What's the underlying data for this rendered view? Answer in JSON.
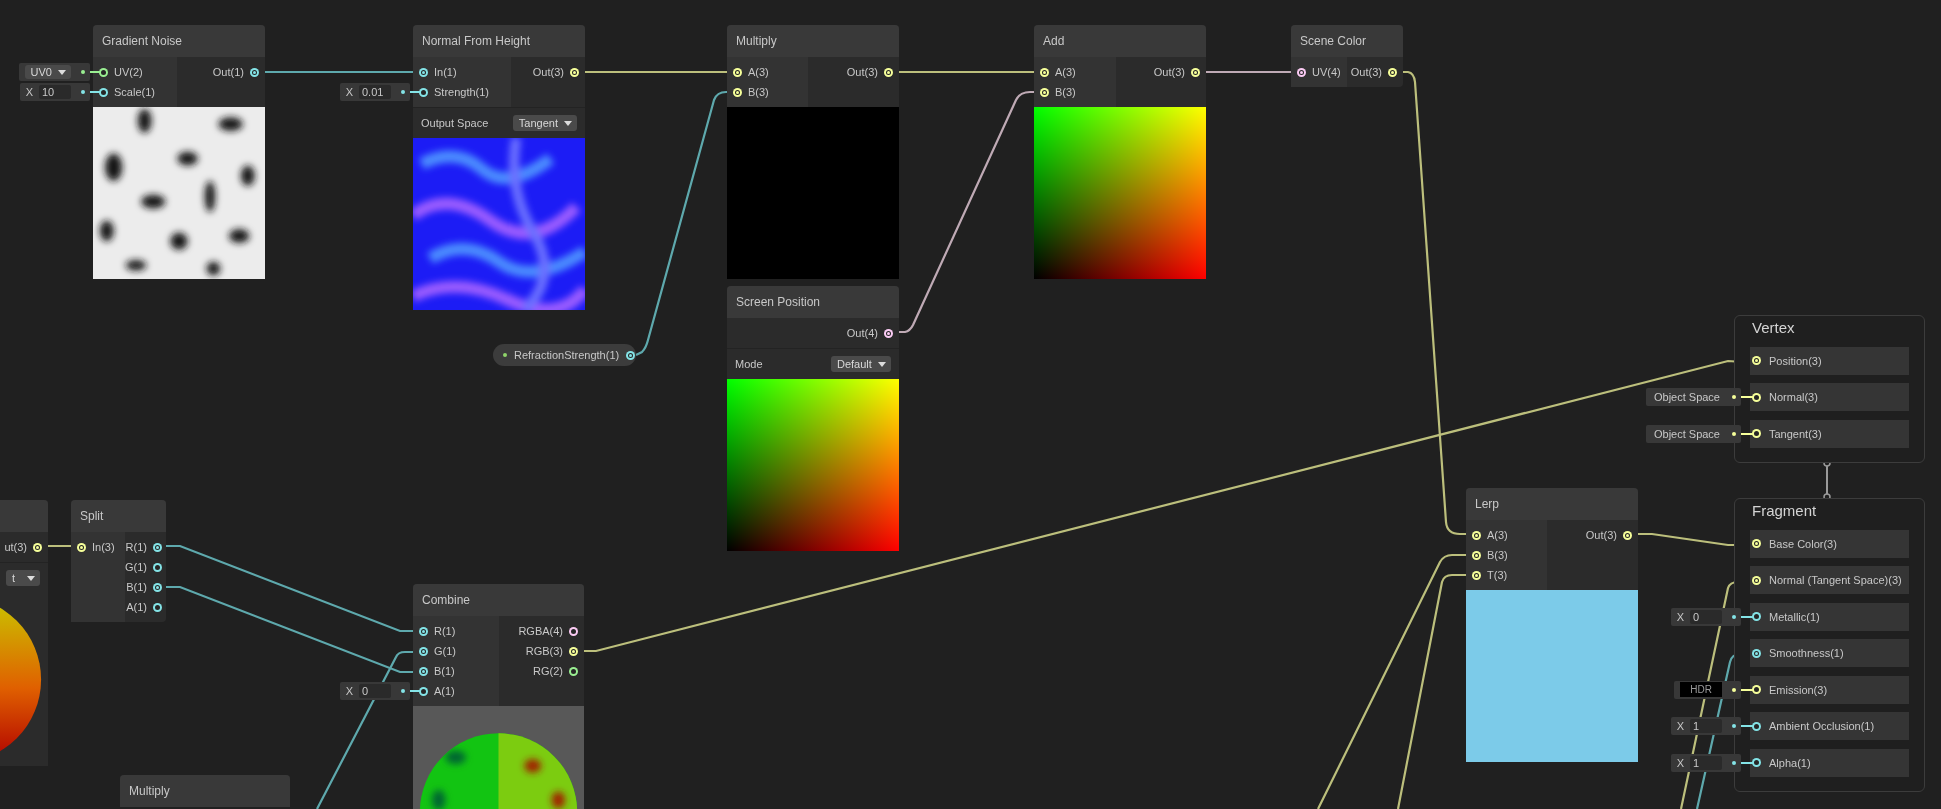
{
  "nodes": [
    {
      "title": "Gradient Noise",
      "inputs": [
        {
          "label": "UV(2)",
          "color": "#9aef92",
          "connected": false,
          "field": {
            "kind": "dropdown",
            "value": "UV0"
          }
        },
        {
          "label": "Scale(1)",
          "color": "#84e4e7",
          "connected": false,
          "field": {
            "kind": "vector",
            "axis": "X",
            "value": "10"
          }
        }
      ],
      "outputs": [
        {
          "label": "Out(1)",
          "color": "#84e4e7",
          "connected": true
        }
      ],
      "preview": {
        "kind": "noise"
      }
    },
    {
      "title": "Normal From Height",
      "inputs": [
        {
          "label": "In(1)",
          "color": "#84e4e7",
          "connected": true
        },
        {
          "label": "Strength(1)",
          "color": "#84e4e7",
          "connected": false,
          "field": {
            "kind": "vector",
            "axis": "X",
            "value": "0.01"
          }
        }
      ],
      "outputs": [
        {
          "label": "Out(3)",
          "color": "#f6ff9a",
          "connected": true
        }
      ],
      "settings": [
        {
          "label": "Output Space",
          "value": "Tangent"
        }
      ],
      "preview": {
        "kind": "normal"
      }
    },
    {
      "title": "Multiply",
      "inputs": [
        {
          "label": "A(3)",
          "color": "#f6ff9a",
          "connected": true
        },
        {
          "label": "B(3)",
          "color": "#f6ff9a",
          "connected": true
        }
      ],
      "outputs": [
        {
          "label": "Out(3)",
          "color": "#f6ff9a",
          "connected": true
        }
      ],
      "preview": {
        "kind": "black"
      }
    },
    {
      "title": "Screen Position",
      "outputs": [
        {
          "label": "Out(4)",
          "color": "#fbcbf4",
          "connected": true
        }
      ],
      "settings": [
        {
          "label": "Mode",
          "value": "Default"
        }
      ],
      "preview": {
        "kind": "uv"
      }
    },
    {
      "title": "Add",
      "inputs": [
        {
          "label": "A(3)",
          "color": "#f6ff9a",
          "connected": true
        },
        {
          "label": "B(3)",
          "color": "#f6ff9a",
          "connected": true
        }
      ],
      "outputs": [
        {
          "label": "Out(3)",
          "color": "#f6ff9a",
          "connected": true
        }
      ],
      "preview": {
        "kind": "uv"
      }
    },
    {
      "title": "Scene Color",
      "inputs": [
        {
          "label": "UV(4)",
          "color": "#fbcbf4",
          "connected": true
        }
      ],
      "outputs": [
        {
          "label": "Out(3)",
          "color": "#f6ff9a",
          "connected": true
        }
      ]
    },
    {
      "outputs": [
        {
          "label": "ut(3)",
          "color": "#f6ff9a",
          "connected": true
        }
      ],
      "settings": [
        {
          "value": "t"
        }
      ],
      "preview": {
        "kind": "sphere-gradient"
      }
    },
    {
      "title": "Split",
      "inputs": [
        {
          "label": "In(3)",
          "color": "#f6ff9a",
          "connected": true
        }
      ],
      "outputs": [
        {
          "label": "R(1)",
          "color": "#84e4e7",
          "connected": true
        },
        {
          "label": "G(1)",
          "color": "#84e4e7",
          "connected": false
        },
        {
          "label": "B(1)",
          "color": "#84e4e7",
          "connected": true
        },
        {
          "label": "A(1)",
          "color": "#84e4e7",
          "connected": false
        }
      ]
    },
    {
      "title": "Combine",
      "inputs": [
        {
          "label": "R(1)",
          "color": "#84e4e7",
          "connected": true
        },
        {
          "label": "G(1)",
          "color": "#84e4e7",
          "connected": true
        },
        {
          "label": "B(1)",
          "color": "#84e4e7",
          "connected": true
        },
        {
          "label": "A(1)",
          "color": "#84e4e7",
          "connected": false,
          "field": {
            "kind": "vector",
            "axis": "X",
            "value": "0"
          }
        }
      ],
      "outputs": [
        {
          "label": "RGBA(4)",
          "color": "#fbcbf4",
          "connected": false
        },
        {
          "label": "RGB(3)",
          "color": "#f6ff9a",
          "connected": true
        },
        {
          "label": "RG(2)",
          "color": "#9aef92",
          "connected": false
        }
      ],
      "preview": {
        "kind": "sphere-noise"
      }
    },
    {
      "title": "Lerp",
      "inputs": [
        {
          "label": "A(3)",
          "color": "#f6ff9a",
          "connected": true
        },
        {
          "label": "B(3)",
          "color": "#f6ff9a",
          "connected": true
        },
        {
          "label": "T(3)",
          "color": "#f6ff9a",
          "connected": true
        }
      ],
      "outputs": [
        {
          "label": "Out(3)",
          "color": "#f6ff9a",
          "connected": true
        }
      ],
      "preview": {
        "kind": "blue"
      }
    },
    {
      "title": "Multiply"
    }
  ],
  "properties": [
    {
      "label": "RefractionStrength(1)",
      "color": "#84e4e7",
      "connected": true
    }
  ],
  "contexts": [
    {
      "title": "Vertex",
      "blocks": [
        {
          "label": "Position(3)",
          "color": "#f6ff9a",
          "connected": true
        },
        {
          "label": "Normal(3)",
          "color": "#f6ff9a",
          "connected": false,
          "field": {
            "kind": "space",
            "value": "Object Space"
          }
        },
        {
          "label": "Tangent(3)",
          "color": "#f6ff9a",
          "connected": false,
          "field": {
            "kind": "space",
            "value": "Object Space"
          }
        }
      ]
    },
    {
      "title": "Fragment",
      "blocks": [
        {
          "label": "Base Color(3)",
          "color": "#f6ff9a",
          "connected": true
        },
        {
          "label": "Normal (Tangent Space)(3)",
          "color": "#f6ff9a",
          "connected": true
        },
        {
          "label": "Metallic(1)",
          "color": "#84e4e7",
          "connected": false,
          "field": {
            "kind": "vector",
            "axis": "X",
            "value": "0"
          }
        },
        {
          "label": "Smoothness(1)",
          "color": "#84e4e7",
          "connected": true
        },
        {
          "label": "Emission(3)",
          "color": "#f6ff9a",
          "connected": false,
          "field": {
            "kind": "hdr",
            "value": "HDR"
          }
        },
        {
          "label": "Ambient Occlusion(1)",
          "color": "#84e4e7",
          "connected": false,
          "field": {
            "kind": "vector",
            "axis": "X",
            "value": "1"
          }
        },
        {
          "label": "Alpha(1)",
          "color": "#84e4e7",
          "connected": false,
          "field": {
            "kind": "vector",
            "axis": "X",
            "value": "1"
          }
        }
      ]
    }
  ]
}
